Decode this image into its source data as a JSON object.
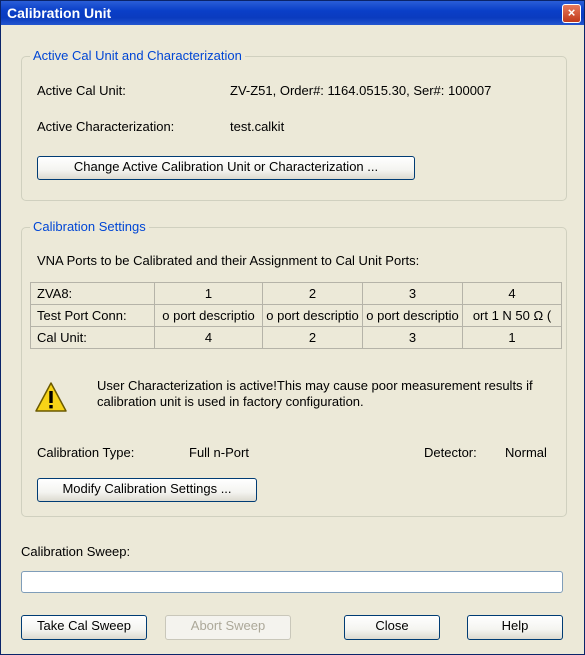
{
  "window": {
    "title": "Calibration Unit",
    "close_glyph": "×"
  },
  "active_group": {
    "legend": "Active Cal Unit and Characterization",
    "unit_label": "Active Cal Unit:",
    "unit_value": "ZV-Z51, Order#: 1164.0515.30, Ser#: 100007",
    "char_label": "Active Characterization:",
    "char_value": "test.calkit",
    "change_button": "Change Active Calibration Unit or Characterization ..."
  },
  "settings_group": {
    "legend": "Calibration Settings",
    "ports_caption": "VNA Ports to be Calibrated and their Assignment to Cal Unit Ports:",
    "table": {
      "rows": [
        [
          "ZVA8:",
          "1",
          "2",
          "3",
          "4"
        ],
        [
          "Test Port Conn:",
          "o port descriptio",
          "o port descriptio",
          "o port descriptio",
          "ort 1   N 50 Ω ("
        ],
        [
          "Cal Unit:",
          "4",
          "2",
          "3",
          "1"
        ]
      ]
    },
    "warning_icon": "warning-icon",
    "warning_text": "User Characterization is active!This may cause poor measurement results if calibration unit is used in factory configuration.",
    "cal_type_label": "Calibration Type:",
    "cal_type_value": "Full n-Port",
    "detector_label": "Detector:",
    "detector_value": "Normal",
    "modify_button": "Modify Calibration Settings ..."
  },
  "sweep": {
    "label": "Calibration Sweep:",
    "progress": 0
  },
  "buttons": {
    "take": "Take Cal Sweep",
    "abort": "Abort Sweep",
    "close": "Close",
    "help": "Help"
  },
  "colors": {
    "title_bar": "#0a3fc8",
    "legend_text": "#0046d5",
    "dialog_bg": "#ece9d8"
  }
}
